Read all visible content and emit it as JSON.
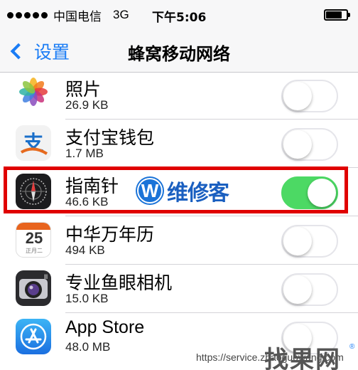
{
  "status_bar": {
    "carrier": "中国电信",
    "network": "3G",
    "time": "下午5:06",
    "battery_level": 0.8
  },
  "nav": {
    "back_label": "设置",
    "title": "蜂窝移动网络"
  },
  "apps": [
    {
      "name": "照片",
      "size": "26.9 KB",
      "enabled": false
    },
    {
      "name": "支付宝钱包",
      "size": "1.7 MB",
      "enabled": false
    },
    {
      "name": "指南针",
      "size": "46.6 KB",
      "enabled": true
    },
    {
      "name": "中华万年历",
      "size": "494 KB",
      "enabled": false
    },
    {
      "name": "专业鱼眼相机",
      "size": "15.0 KB",
      "enabled": false
    },
    {
      "name": "App Store",
      "size": "48.0 MB",
      "enabled": false
    }
  ],
  "calendar_icon": {
    "day": "25",
    "caption": "正月二"
  },
  "overlay_logo": {
    "mark": "W",
    "text": "维修客"
  },
  "watermark": {
    "url": "https://service.zhaoguowang.com",
    "logo": "找果网",
    "registered": "®"
  },
  "colors": {
    "accent": "#1a7cf5",
    "toggle_on": "#4cd964",
    "highlight": "#e00000"
  }
}
